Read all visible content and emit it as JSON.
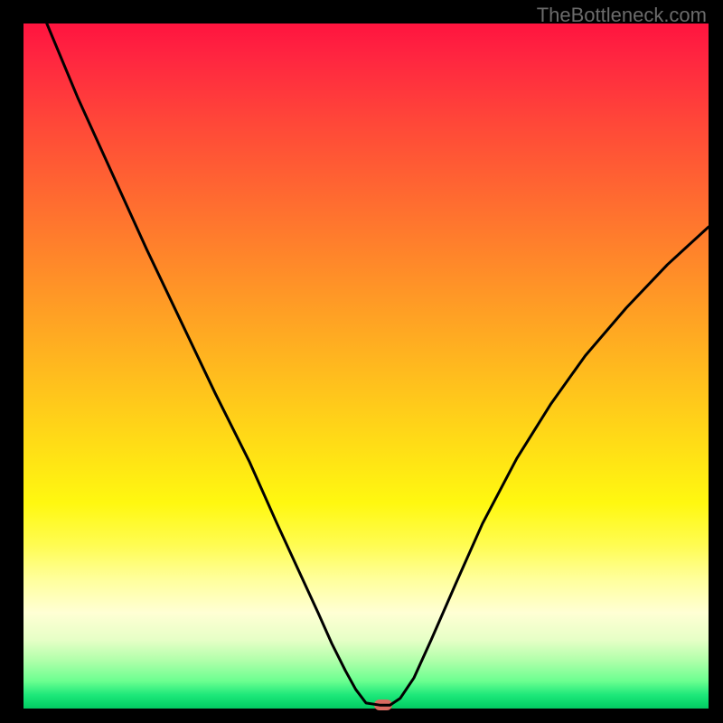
{
  "watermark": "TheBottleneck.com",
  "chart_data": {
    "type": "line",
    "title": "",
    "xlabel": "",
    "ylabel": "",
    "xlim": [
      0,
      100
    ],
    "ylim": [
      0,
      100
    ],
    "grid": false,
    "series": [
      {
        "name": "curve",
        "x": [
          3.4,
          8,
          13,
          18,
          23,
          28,
          33,
          37,
          40,
          43,
          45,
          47,
          48.5,
          50,
          52,
          53.5,
          55,
          57,
          59.5,
          63,
          67,
          72,
          77,
          82,
          88,
          94,
          100
        ],
        "y": [
          100,
          89,
          78,
          67,
          56.5,
          46,
          36,
          27,
          20.5,
          14,
          9.5,
          5.5,
          2.8,
          0.8,
          0.5,
          0.5,
          1.5,
          4.5,
          10,
          18,
          27,
          36.5,
          44.5,
          51.5,
          58.5,
          64.8,
          70.3
        ]
      }
    ],
    "marker": {
      "x": 52.5,
      "y": 0.5
    },
    "gradient_stops": [
      {
        "pos": 0,
        "color": "#ff143f"
      },
      {
        "pos": 50,
        "color": "#ffc21c"
      },
      {
        "pos": 80,
        "color": "#ffff9a"
      },
      {
        "pos": 100,
        "color": "#06c862"
      }
    ]
  }
}
